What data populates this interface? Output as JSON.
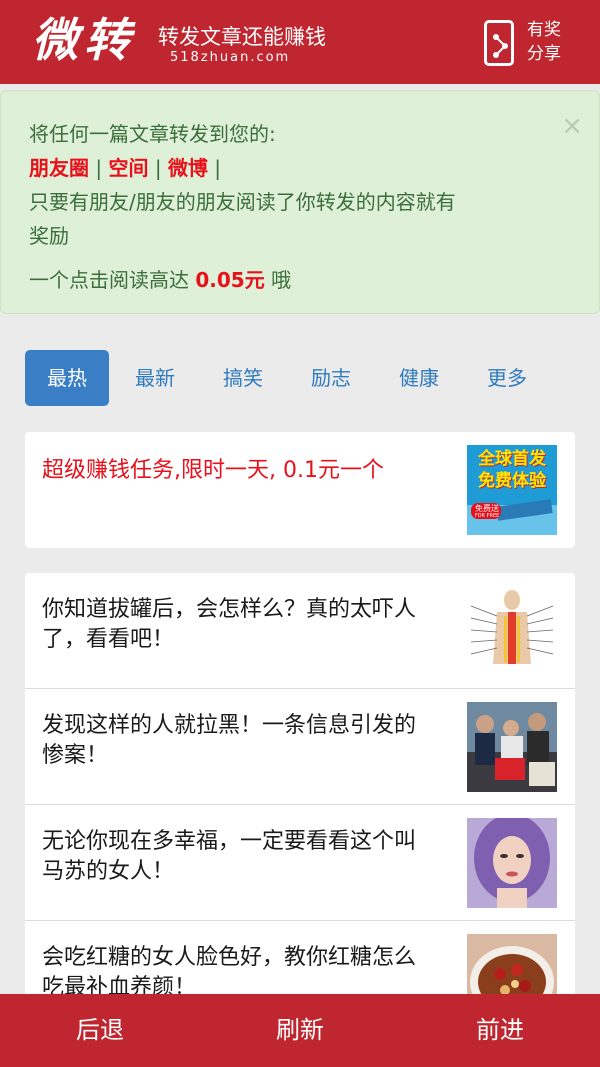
{
  "header": {
    "logo": "微转",
    "tagline": "转发文章还能赚钱",
    "domain": "518zhuan.com",
    "share_label_line1": "有奖",
    "share_label_line2": "分享"
  },
  "notice": {
    "close": "×",
    "line1": "将任何一篇文章转发到您的:",
    "platforms": [
      "朋友圈",
      "空间",
      "微博"
    ],
    "separator": "|",
    "line3": "只要有朋友/朋友的朋友阅读了你转发的内容就有",
    "line4": "奖励",
    "reward_prefix": "一个点击阅读高达 ",
    "reward_amount": "0.05元",
    "reward_suffix": " 哦"
  },
  "tabs": [
    "最热",
    "最新",
    "搞笑",
    "励志",
    "健康",
    "更多"
  ],
  "promo": {
    "title": "超级赚钱任务,限时一天, 0.1元一个",
    "badge_line1": "全球首发",
    "badge_line2": "免费体验",
    "badge_tag": "免费送",
    "badge_sub": "FOR FREE"
  },
  "articles": [
    {
      "title": "你知道拔罐后，会怎样么？真的太吓人了，看看吧！",
      "thumb_icon": "acupuncture-chart-thumb"
    },
    {
      "title": "发现这样的人就拉黑！一条信息引发的惨案！",
      "thumb_icon": "crowd-photo-thumb"
    },
    {
      "title": "无论你现在多幸福，一定要看看这个叫马苏的女人！",
      "thumb_icon": "woman-portrait-thumb"
    },
    {
      "title": "会吃红糖的女人脸色好，教你红糖怎么吃最补血养颜！",
      "thumb_icon": "food-bowl-thumb"
    }
  ],
  "footer": {
    "back": "后退",
    "refresh": "刷新",
    "forward": "前进"
  },
  "colors": {
    "brand_red": "#c0262f",
    "notice_bg": "#dff0d8",
    "tab_active": "#3a7ec5",
    "highlight_red": "#e8101a"
  }
}
